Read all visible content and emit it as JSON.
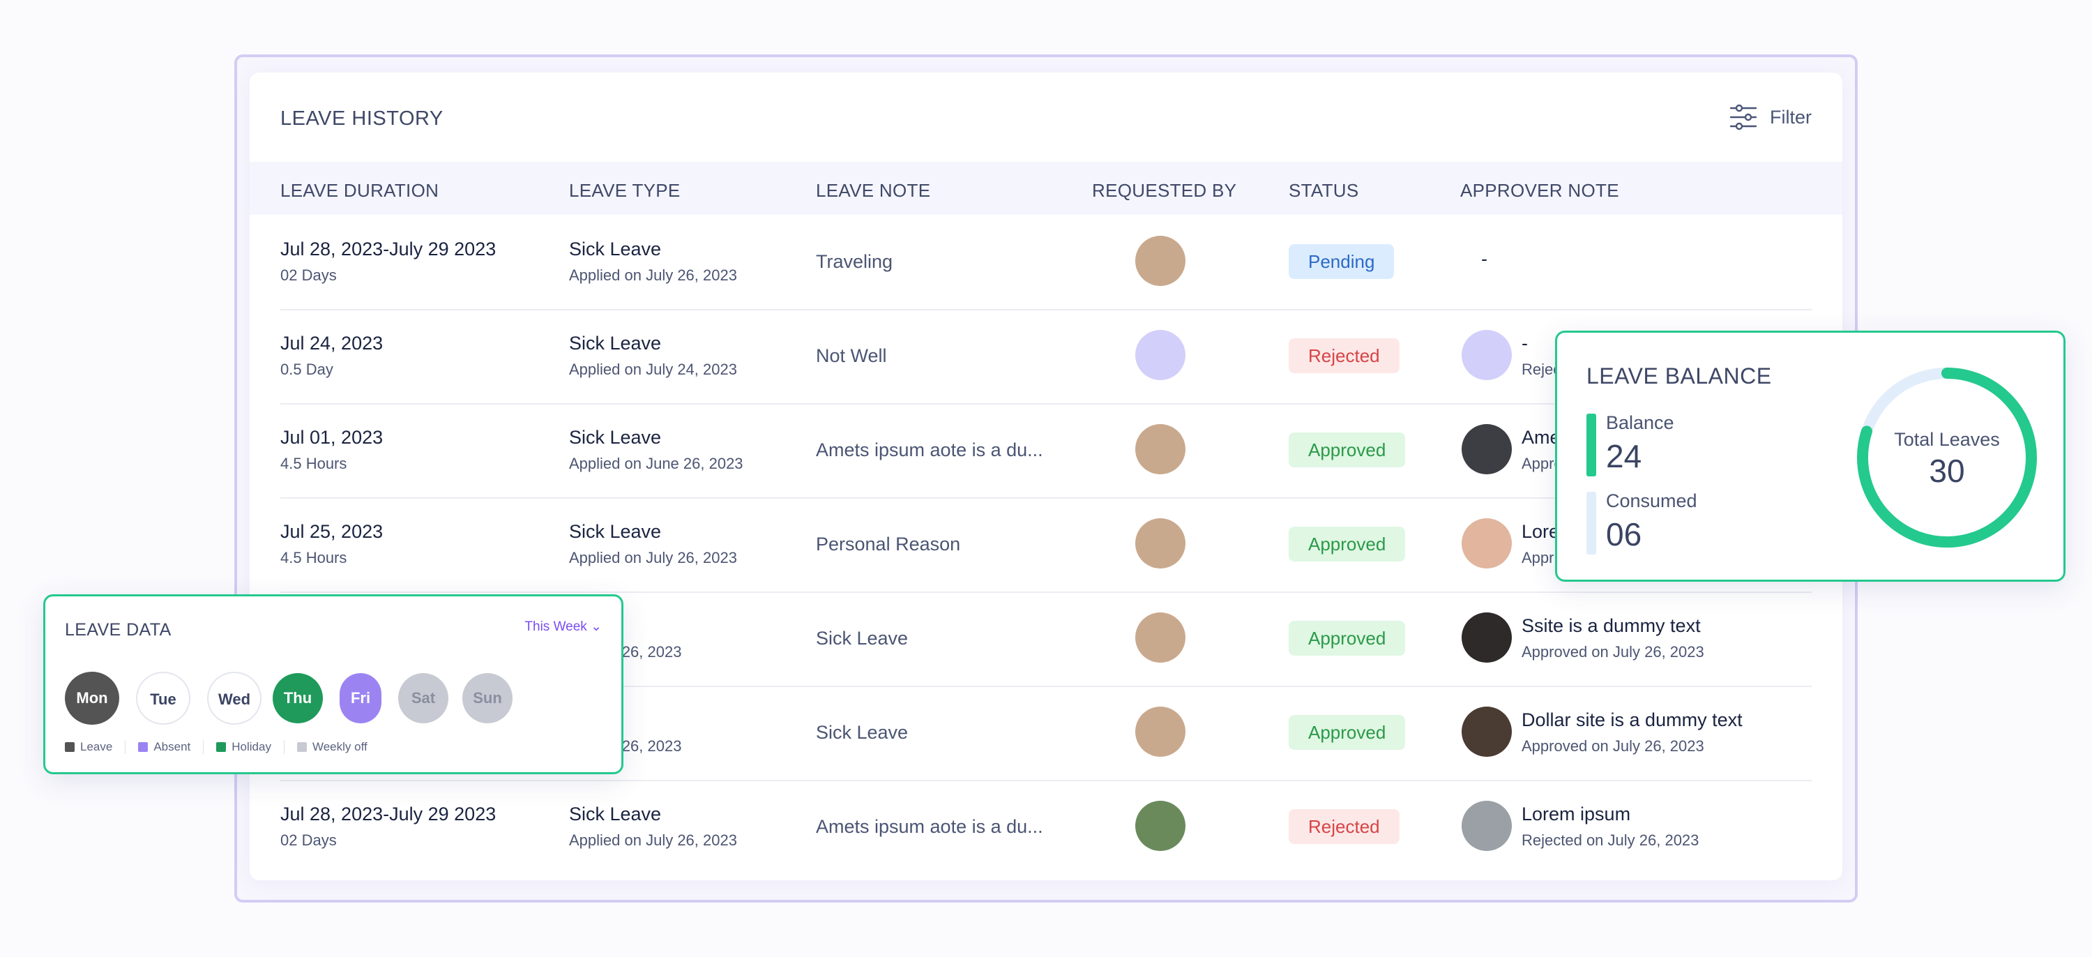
{
  "history": {
    "title": "LEAVE HISTORY",
    "filter_label": "Filter",
    "columns": [
      "LEAVE DURATION",
      "LEAVE TYPE",
      "LEAVE NOTE",
      "REQUESTED BY",
      "STATUS",
      "APPROVER NOTE"
    ],
    "rows": [
      {
        "date": "Jul 28, 2023-July 29 2023",
        "duration": "02 Days",
        "type": "Sick Leave",
        "applied": "Applied on  July 26, 2023",
        "note": "Traveling",
        "status": "Pending",
        "approver_note": "-",
        "approver_sub": ""
      },
      {
        "date": "Jul 24, 2023",
        "duration": "0.5 Day",
        "type": "Sick Leave",
        "applied": "Applied on  July 24, 2023",
        "note": "Not Well",
        "status": "Rejected",
        "approver_note": "-",
        "approver_sub": "Rejec"
      },
      {
        "date": "Jul 01, 2023",
        "duration": "4.5 Hours",
        "type": "Sick Leave",
        "applied": "Applied on  June 26, 2023",
        "note": "Amets ipsum aote is a du...",
        "status": "Approved",
        "approver_note": "Ame",
        "approver_sub": "Appro"
      },
      {
        "date": "Jul 25, 2023",
        "duration": "4.5 Hours",
        "type": "Sick Leave",
        "applied": "Applied on  July 26, 2023",
        "note": "Personal Reason",
        "status": "Approved",
        "approver_note": "Lore",
        "approver_sub": "Appr"
      },
      {
        "date": "",
        "duration": "",
        "type": "eave",
        "applied": "on  July 26, 2023",
        "note": "Sick Leave",
        "status": "Approved",
        "approver_note": "Ssite is a dummy text",
        "approver_sub": "Approved on July 26, 2023"
      },
      {
        "date": "",
        "duration": "",
        "type": "eave",
        "applied": "on  July 26, 2023",
        "note": "Sick Leave",
        "status": "Approved",
        "approver_note": "Dollar site is a dummy text",
        "approver_sub": "Approved on July 26, 2023"
      },
      {
        "date": "Jul 28, 2023-July 29 2023",
        "duration": "02 Days",
        "type": "Sick Leave",
        "applied": "Applied on  July 26, 2023",
        "note": "Amets ipsum aote is a du...",
        "status": "Rejected",
        "approver_note": "Lorem ipsum",
        "approver_sub": "Rejected on July 26, 2023"
      }
    ]
  },
  "balance": {
    "title": "LEAVE BALANCE",
    "balance_label": "Balance",
    "balance_value": "24",
    "consumed_label": "Consumed",
    "consumed_value": "06",
    "total_label": "Total Leaves",
    "total_value": "30",
    "balance_fraction": 0.8
  },
  "leave_data": {
    "title": "LEAVE DATA",
    "period": "This Week",
    "days": [
      "Mon",
      "Tue",
      "Wed",
      "Thu",
      "Fri",
      "Sat",
      "Sun"
    ],
    "legend": [
      "Leave",
      "Absent",
      "Holiday",
      "Weekly off"
    ]
  },
  "colors": {
    "accent_green": "#24c98d",
    "leave": "#545454",
    "absent": "#9b84f2",
    "holiday": "#1f9a5b",
    "weekly_off": "#c7cad3"
  }
}
